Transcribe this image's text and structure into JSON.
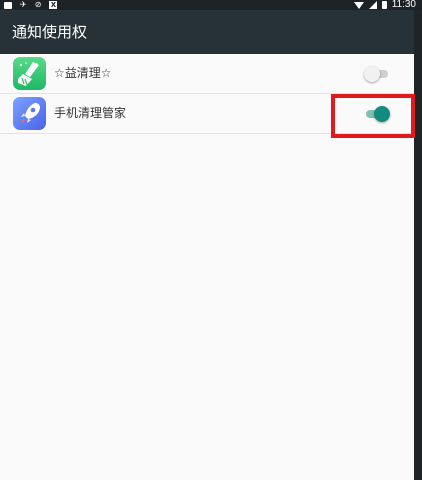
{
  "status_bar": {
    "time": "11:30",
    "left_icons": [
      "notification-square-icon",
      "airplane-icon",
      "dnd-icon",
      "x-box-icon"
    ],
    "right_icons": [
      "wifi-icon",
      "signal-icon",
      "battery-icon"
    ]
  },
  "app_bar": {
    "title": "通知使用权"
  },
  "apps": [
    {
      "label": "☆益清理☆",
      "icon": "broom-cleaner-icon",
      "icon_color": "#2fbf6b",
      "toggle_on": false
    },
    {
      "label": "手机清理管家",
      "icon": "rocket-icon",
      "icon_color": "#5b78f2",
      "toggle_on": true
    }
  ],
  "colors": {
    "app_bar": "#263238",
    "toggle_on_thumb": "#128c7e",
    "toggle_on_track": "#7fbfb3",
    "toggle_off_thumb": "#f1f1f1",
    "toggle_off_track": "#cfcfcf",
    "highlight": "#e01b1b"
  }
}
